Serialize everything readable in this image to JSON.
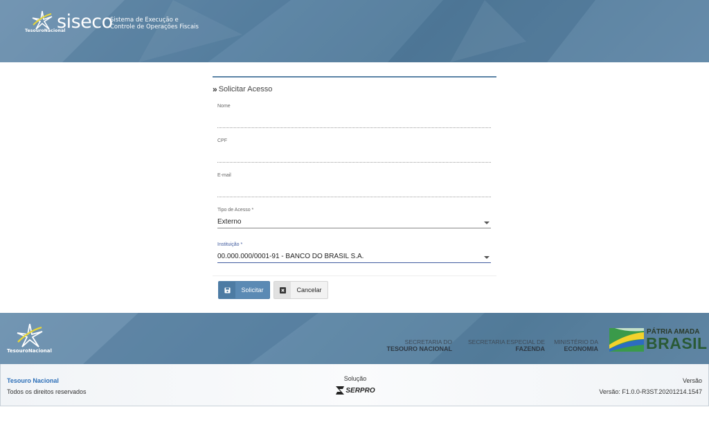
{
  "header": {
    "brand_small": "TesouroNacional",
    "app_name": "siseco",
    "app_desc_line1": "Sistema de Execução e",
    "app_desc_line2": "Controle de Operações Fiscais"
  },
  "form": {
    "title": "Solicitar Acesso",
    "fields": {
      "nome": {
        "label": "Nome",
        "value": ""
      },
      "cpf": {
        "label": "CPF",
        "value": ""
      },
      "email": {
        "label": "E-mail",
        "value": ""
      },
      "tipo": {
        "label": "Tipo de Acesso *",
        "value": "Externo"
      },
      "instituicao": {
        "label": "Instituição *",
        "value": "00.000.000/0001-91 - BANCO DO BRASIL S.A."
      }
    },
    "submit_label": "Solicitar",
    "cancel_label": "Cancelar"
  },
  "footer_band": {
    "brand_small": "TesouroNacional",
    "ministries": [
      {
        "line1": "SECRETARIA DO",
        "line2": "TESOURO NACIONAL"
      },
      {
        "line1": "SECRETARIA ESPECIAL DE",
        "line2": "FAZENDA"
      },
      {
        "line1": "MINISTÉRIO DA",
        "line2": "ECONOMIA"
      }
    ],
    "patria_line1": "PÁTRIA AMADA",
    "patria_line2": "BRASIL"
  },
  "footer": {
    "org_name": "Tesouro Nacional",
    "rights": "Todos os direitos reservados",
    "solution_label": "Solução",
    "solution_brand": "SERPRO",
    "version_label": "Versão",
    "version_value": "Versão: F1.0.0-R3ST.20201214.1547"
  },
  "colors": {
    "header_blue": "#5a83a3",
    "primary_button": "#5b8ab4",
    "focus_indigo": "#3f5a9e",
    "link_blue": "#2d6fb8"
  }
}
